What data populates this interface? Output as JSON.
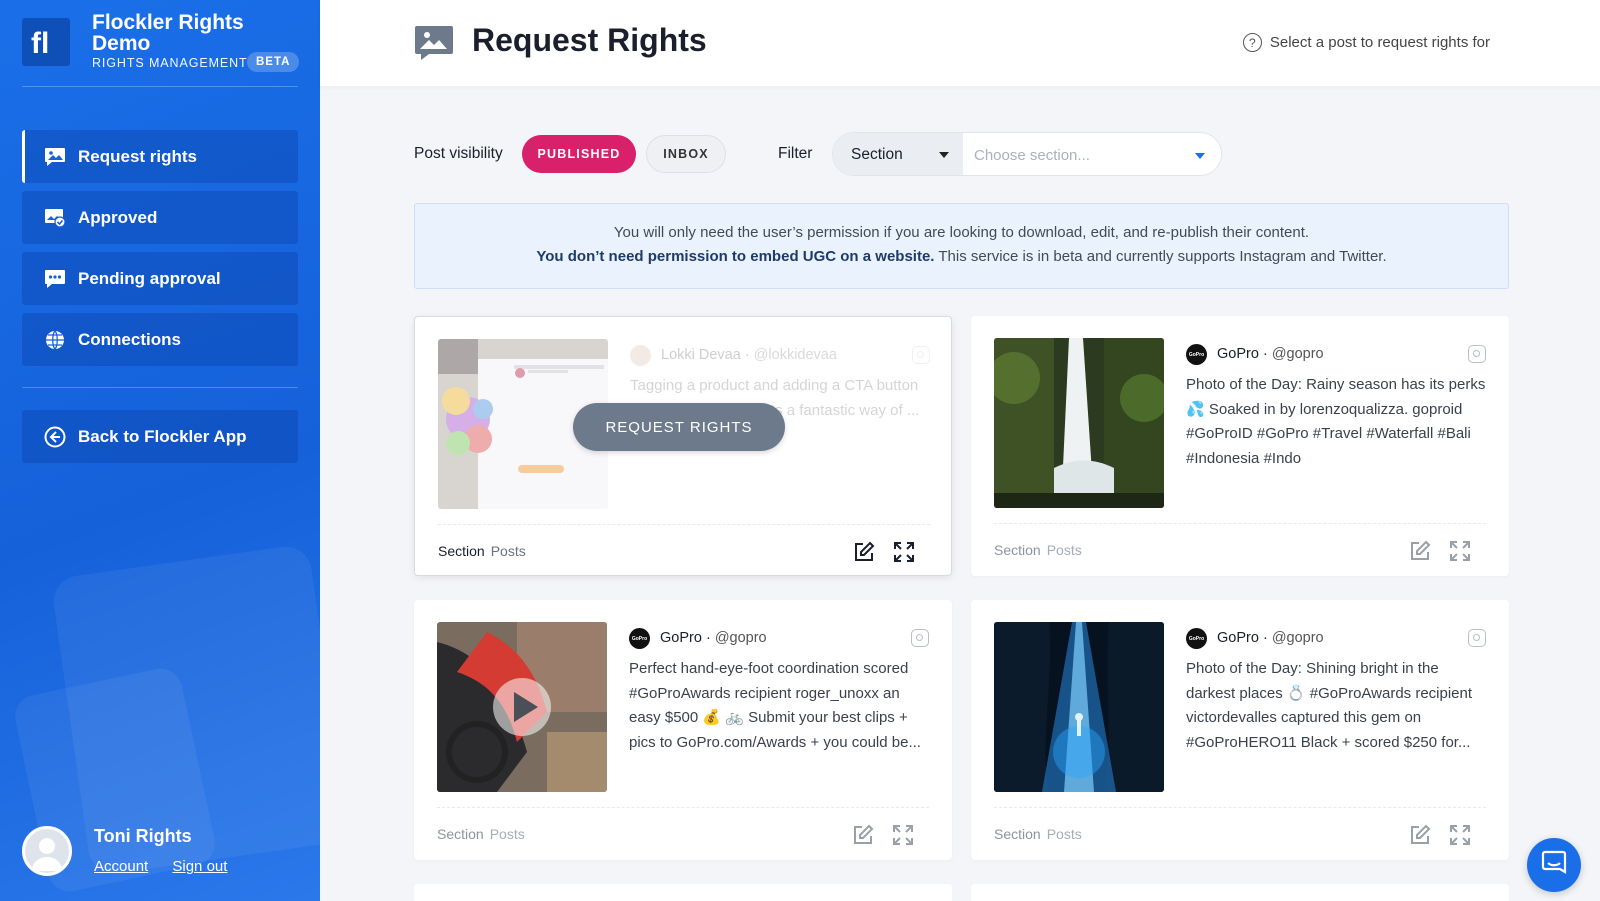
{
  "brand": {
    "name": "Flockler Rights Demo",
    "subtitle": "RIGHTS MANAGEMENT",
    "badge": "BETA"
  },
  "nav": {
    "items": [
      {
        "label": "Request rights",
        "icon": "image-chat-icon",
        "active": true
      },
      {
        "label": "Approved",
        "icon": "image-check-icon"
      },
      {
        "label": "Pending approval",
        "icon": "chat-dots-icon"
      },
      {
        "label": "Connections",
        "icon": "globe-icon"
      }
    ],
    "back_label": "Back to Flockler App"
  },
  "user": {
    "name": "Toni Rights",
    "account_label": "Account",
    "signout_label": "Sign out"
  },
  "header": {
    "title": "Request Rights",
    "help_text": "Select a post to request rights for"
  },
  "filters": {
    "visibility_label": "Post visibility",
    "published_label": "PUBLISHED",
    "inbox_label": "INBOX",
    "filter_label": "Filter",
    "section_select": "Section",
    "section_placeholder": "Choose section..."
  },
  "info": {
    "line1": "You will only need the user’s permission if you are looking to download, edit, and re-publish their content.",
    "line2_bold": "You don’t need permission to embed UGC on a website.",
    "line2_rest": " This service is in beta and currently supports Instagram and Twitter."
  },
  "posts": [
    {
      "author": "Lokki Devaa",
      "handle": "@lokkidevaa",
      "caption": "Tagging a product and adding a CTA button to a social media posts a fantastic way of ...",
      "section_label": "Section",
      "section_value": "Posts",
      "request_label": "REQUEST RIGHTS"
    },
    {
      "author": "GoPro",
      "handle": "@gopro",
      "caption": "Photo of the Day: Rainy season has its perks 💦 Soaked in by lorenzoqualizza. goproid #GoProID #GoPro #Travel #Waterfall #Bali #Indonesia #Indo",
      "section_label": "Section",
      "section_value": "Posts"
    },
    {
      "author": "GoPro",
      "handle": "@gopro",
      "caption": "Perfect hand-eye-foot coordination scored #GoProAwards recipient roger_unoxx an easy $500 💰 🚲 Submit your best clips + pics to GoPro.com/Awards + you could be...",
      "section_label": "Section",
      "section_value": "Posts"
    },
    {
      "author": "GoPro",
      "handle": "@gopro",
      "caption": "Photo of the Day: Shining bright in the darkest places 💍 #GoProAwards recipient victordevalles captured this gem on #GoProHERO11 Black + scored $250 for...",
      "section_label": "Section",
      "section_value": "Posts"
    }
  ],
  "avatar_text": "GoPro",
  "colors": {
    "sidebar": "#1a6fe8",
    "accent_pink": "#d9206b",
    "info_bg": "#eaf2fd"
  }
}
